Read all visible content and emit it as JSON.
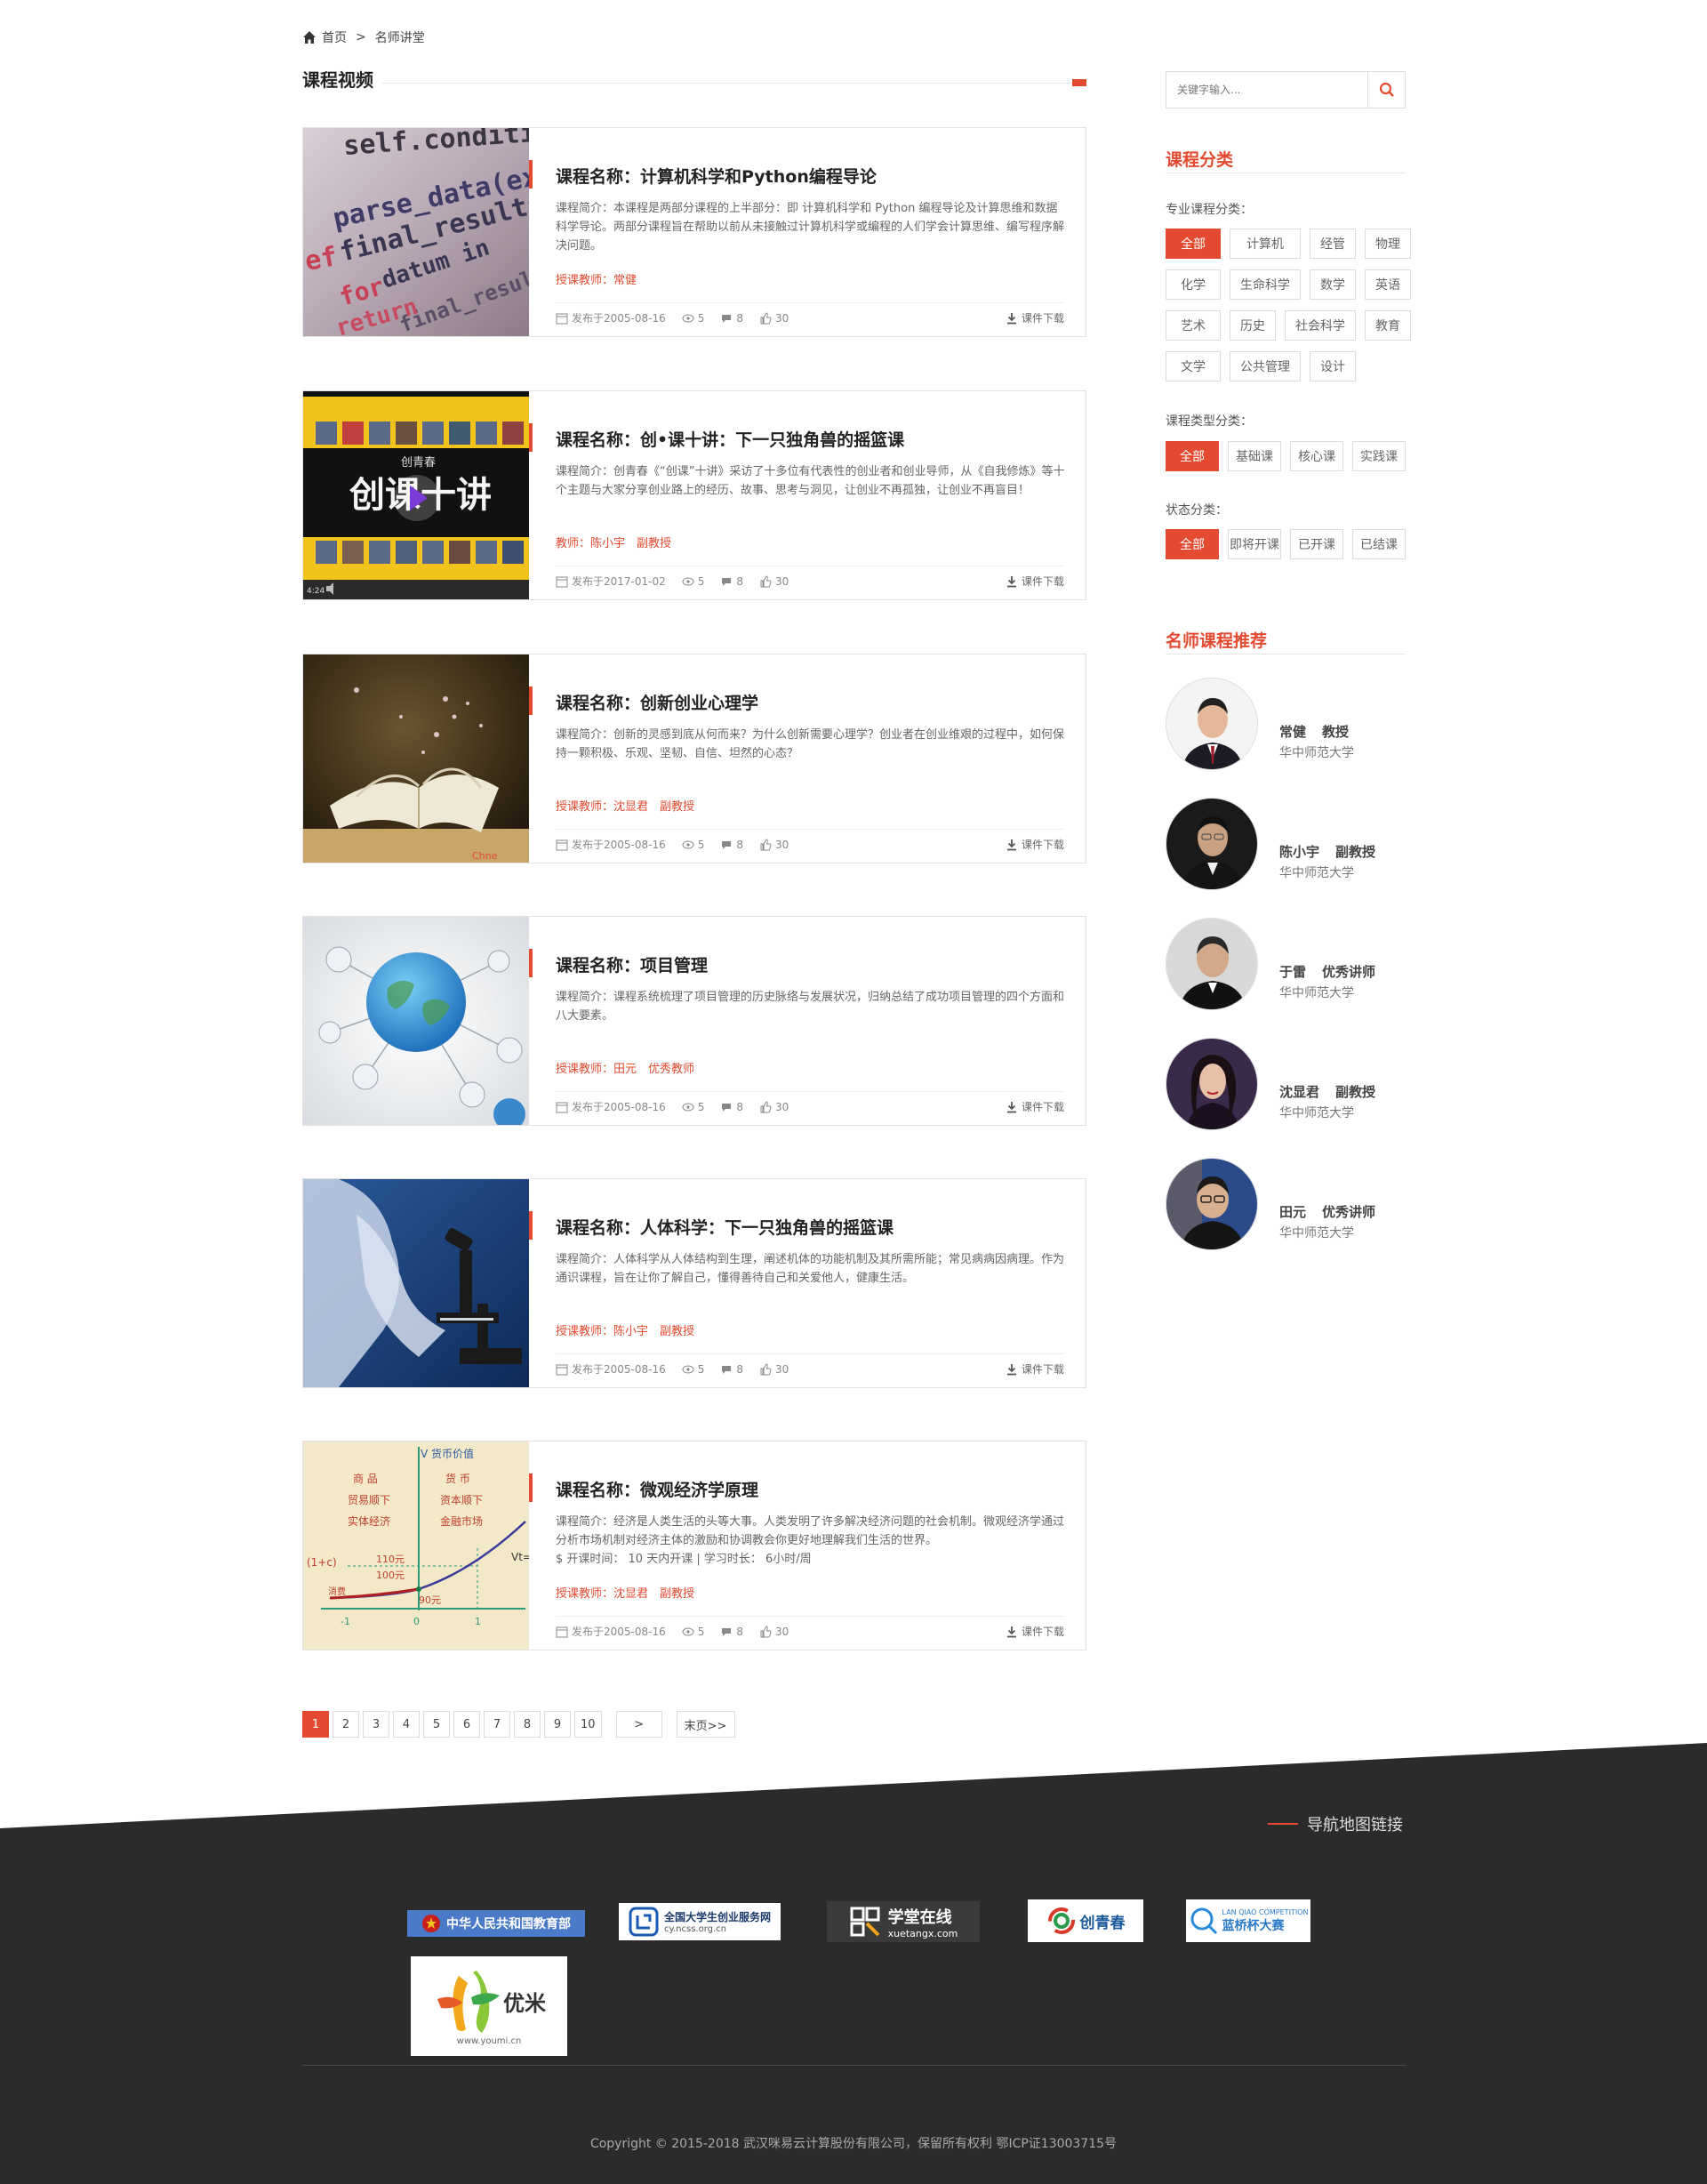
{
  "breadcrumb": {
    "home": "首页",
    "separator": ">",
    "current": "名师讲堂"
  },
  "section": {
    "title": "课程视频"
  },
  "meta_labels": {
    "published_prefix": "发布于",
    "download": "课件下载"
  },
  "courses": [
    {
      "title": "课程名称：计算机科学和Python编程导论",
      "intro": "课程简介：本课程是两部分课程的上半部分：即 计算机科学和 Python 编程导论及计算思维和数据科学导论。两部分课程旨在帮助以前从未接触过计算机科学或编程的人们学会计算思维、编写程序解决问题。",
      "teacher": "授课教师：常健",
      "date": "发布于2005-08-16",
      "views": "5",
      "comments": "8",
      "likes": "30",
      "thumb": "code-screen"
    },
    {
      "title": "课程名称：创•课十讲：下一只独角兽的摇篮课",
      "intro": "课程简介：创青春《“创课”十讲》采访了十多位有代表性的创业者和创业导师，从《自我修炼》等十个主题与大家分享创业路上的经历、故事、思考与洞见，让创业不再孤独，让创业不再盲目！",
      "teacher": "教师：陈小宇　副教授",
      "date": "发布于2017-01-02",
      "views": "5",
      "comments": "8",
      "likes": "30",
      "thumb": "video-player",
      "thumb_text": {
        "brand": "创青春",
        "main": "创课十讲",
        "time": "4:24"
      }
    },
    {
      "title": "课程名称：创新创业心理学",
      "intro": "课程简介：创新的灵感到底从何而来？为什么创新需要心理学？创业者在创业维艰的过程中，如何保持一颗积极、乐观、坚韧、自信、坦然的心态？",
      "teacher": "授课教师：沈显君　副教授",
      "date": "发布于2005-08-16",
      "views": "5",
      "comments": "8",
      "likes": "30",
      "thumb": "open-book"
    },
    {
      "title": "课程名称：项目管理",
      "intro": "课程简介：课程系统梳理了项目管理的历史脉络与发展状况，归纳总结了成功项目管理的四个方面和八大要素。",
      "teacher": "授课教师：田元　优秀教师",
      "date": "发布于2005-08-16",
      "views": "5",
      "comments": "8",
      "likes": "30",
      "thumb": "globe-network"
    },
    {
      "title": "课程名称：人体科学：下一只独角兽的摇篮课",
      "intro": "课程简介：人体科学从人体结构到生理，阐述机体的功能机制及其所需所能；常见病病因病理。作为通识课程，旨在让你了解自己，懂得善待自己和关爱他人，健康生活。",
      "teacher": "授课教师：陈小宇　副教授",
      "date": "发布于2005-08-16",
      "views": "5",
      "comments": "8",
      "likes": "30",
      "thumb": "microscope"
    },
    {
      "title": "课程名称：微观经济学原理",
      "intro": "课程简介：经济是人类生活的头等大事。人类发明了许多解决经济问题的社会机制。微观经济学通过分析市场机制对经济主体的激励和协调教会你更好地理解我们生活的世界。",
      "extra": "$ 开课时间： 10 天内开课 | 学习时长： 6小时/周",
      "teacher": "授课教师：沈显君　副教授",
      "date": "发布于2005-08-16",
      "views": "5",
      "comments": "8",
      "likes": "30",
      "thumb": "econ-chart",
      "thumb_text": {
        "axis": "V 货币价值",
        "left1": "商 品",
        "left2": "贸易顺下",
        "left3": "实体经济",
        "right1": "货 币",
        "right2": "资本顺下",
        "right3": "金融市场",
        "v110": "110元",
        "v100": "100元",
        "v90": "90元",
        "consume": "消费",
        "formula": "(1+c)",
        "vt": "Vt=",
        "xm1": "-1",
        "x0": "0",
        "x1": "1"
      }
    }
  ],
  "pagination": {
    "pages": [
      "1",
      "2",
      "3",
      "4",
      "5",
      "6",
      "7",
      "8",
      "9",
      "10"
    ],
    "active": "1",
    "next": ">",
    "last": "末页>>"
  },
  "sidebar": {
    "search_placeholder": "关键字输入...",
    "category_title": "课程分类",
    "major_label": "专业课程分类：",
    "major_tags": [
      "全部",
      "计算机",
      "经管",
      "物理",
      "化学",
      "生命科学",
      "数学",
      "英语",
      "艺术",
      "历史",
      "社会科学",
      "教育",
      "文学",
      "公共管理",
      "设计"
    ],
    "type_label": "课程类型分类：",
    "type_tags": [
      "全部",
      "基础课",
      "核心课",
      "实践课"
    ],
    "status_label": "状态分类：",
    "status_tags": [
      "全部",
      "即将开课",
      "已开课",
      "已结课"
    ],
    "recommend_title": "名师课程推荐",
    "teachers": [
      {
        "name": "常健",
        "title": "教授",
        "school": "华中师范大学"
      },
      {
        "name": "陈小宇",
        "title": "副教授",
        "school": "华中师范大学"
      },
      {
        "name": "于雷",
        "title": "优秀讲师",
        "school": "华中师范大学"
      },
      {
        "name": "沈显君",
        "title": "副教授",
        "school": "华中师范大学"
      },
      {
        "name": "田元",
        "title": "优秀讲师",
        "school": "华中师范大学"
      }
    ]
  },
  "footer": {
    "nav_link": "导航地图链接",
    "partners": {
      "moe": "中华人民共和国教育部",
      "cy_main": "全国大学生创业服务网",
      "cy_url": "cy.ncss.org.cn",
      "xuetang_main": "学堂在线",
      "xuetang_url": "xuetangx.com",
      "cqc": "创青春",
      "lanqiao_en": "LAN QIAO COMPETITION",
      "lanqiao": "蓝桥杯大赛",
      "youmi": "优米",
      "youmi_url": "www.youmi.cn"
    },
    "copyright": "Copyright © 2015-2018 武汉咪易云计算股份有限公司，保留所有权利 鄂ICP证13003715号"
  },
  "colors": {
    "accent": "#e34a2f",
    "footer_bg": "#2b2b2b"
  }
}
